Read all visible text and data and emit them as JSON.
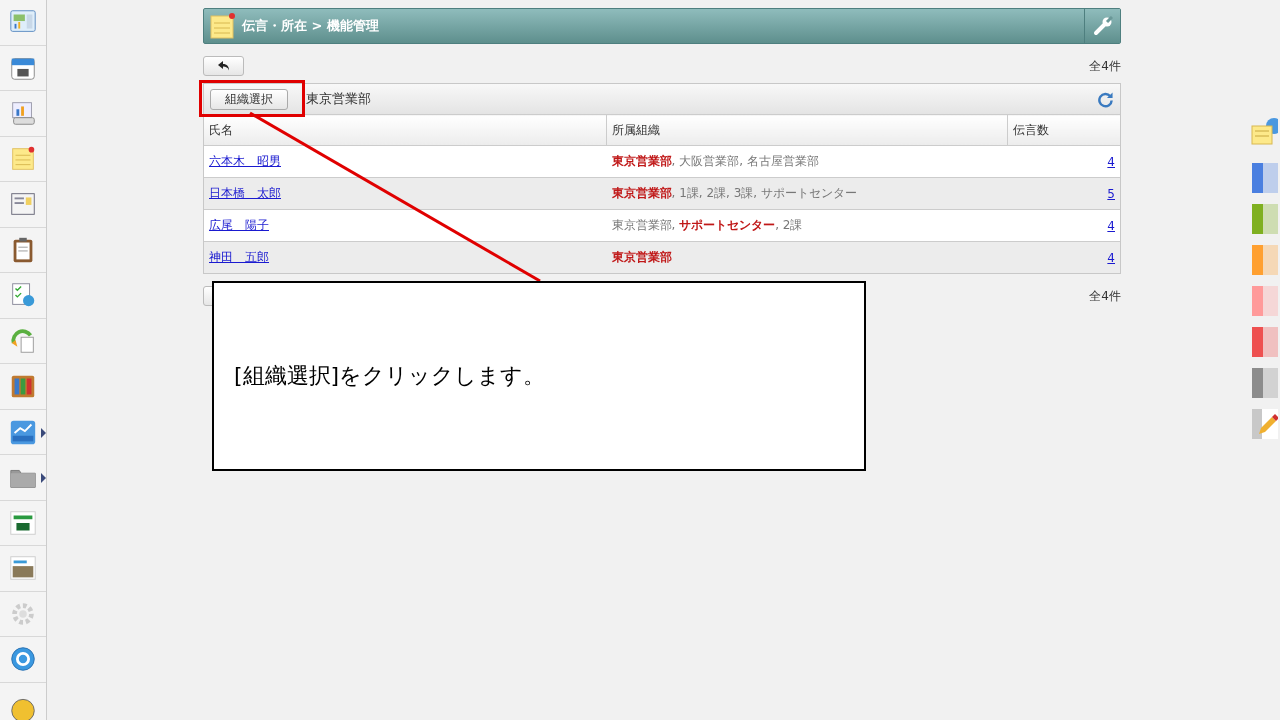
{
  "header": {
    "title": "伝言・所在 > 機能管理"
  },
  "top_count": "全4件",
  "toolbar": {
    "button": "組織選択",
    "org_name": "東京営業部"
  },
  "table": {
    "columns": [
      "氏名",
      "所属組織",
      "伝言数"
    ],
    "rows": [
      {
        "name": "六本木　昭男",
        "orgs": "**東京営業部**, 大阪営業部, 名古屋営業部",
        "count": "4"
      },
      {
        "name": "日本橋　太郎",
        "orgs": "**東京営業部**, 1課, 2課, 3課, サポートセンター",
        "count": "5"
      },
      {
        "name": "広尾　陽子",
        "orgs": "東京営業部, **サポートセンター**, 2課",
        "count": "4"
      },
      {
        "name": "神田　五郎",
        "orgs": "**東京営業部**",
        "count": "4"
      }
    ]
  },
  "bottom_count": "全4件",
  "color_tabs": [
    {
      "color": "#4a7fe0"
    },
    {
      "color": "#7fb020"
    },
    {
      "color": "#ffa030"
    },
    {
      "color": "#ff9a9a"
    },
    {
      "color": "#ee5050"
    },
    {
      "color": "#8c8c8c"
    }
  ],
  "callout": {
    "text": "[組織選択]をクリックします。"
  }
}
